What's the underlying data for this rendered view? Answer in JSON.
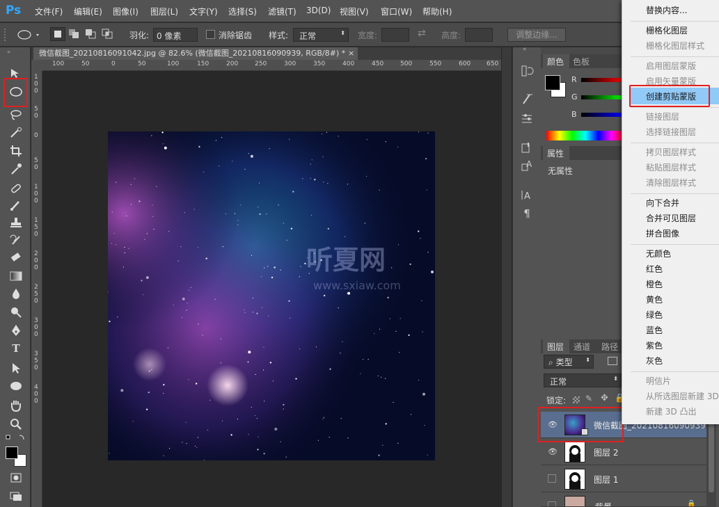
{
  "app": {
    "logo": "Ps"
  },
  "menu": [
    "文件(F)",
    "编辑(E)",
    "图像(I)",
    "图层(L)",
    "文字(Y)",
    "选择(S)",
    "滤镜(T)",
    "3D(D)",
    "视图(V)",
    "窗口(W)",
    "帮助(H)"
  ],
  "options": {
    "feather_label": "羽化:",
    "feather_value": "0 像素",
    "antialias_label": "消除锯齿",
    "style_label": "样式:",
    "style_value": "正常",
    "width_label": "宽度:",
    "height_label": "高度:",
    "refine_button": "调整边缘..."
  },
  "document": {
    "tab_title": "微信截图_20210816091042.jpg @ 82.6% (微信截图_20210816090939, RGB/8#) *",
    "close": "×",
    "ruler_h": [
      "100",
      "50",
      "0",
      "50",
      "100",
      "150",
      "200",
      "250",
      "300",
      "350",
      "400",
      "450",
      "500",
      "550",
      "600",
      "650"
    ],
    "ruler_v": [
      [
        "1",
        "0",
        "0"
      ],
      [
        "5",
        "0"
      ],
      [
        "0"
      ],
      [
        "5",
        "0"
      ],
      [
        "1",
        "0",
        "0"
      ],
      [
        "1",
        "5",
        "0"
      ],
      [
        "2",
        "0",
        "0"
      ],
      [
        "2",
        "5",
        "0"
      ],
      [
        "3",
        "0",
        "0"
      ],
      [
        "3",
        "5",
        "0"
      ],
      [
        "4",
        "0",
        "0"
      ]
    ],
    "watermark": "听夏网",
    "watermark_sub": "www.sxiaw.com"
  },
  "color_panel": {
    "tab_color": "颜色",
    "tab_swatches": "色板",
    "r": "R",
    "g": "G",
    "b": "B"
  },
  "properties_panel": {
    "tab": "属性",
    "content": "无属性"
  },
  "layers_panel": {
    "tab_layers": "图层",
    "tab_channels": "通道",
    "tab_paths": "路径",
    "filter_kind": "类型",
    "blend_mode": "正常",
    "lock_label": "锁定:",
    "layers": [
      {
        "name": "微信截图_20210816090939",
        "visible": true,
        "selected": true
      },
      {
        "name": "图层 2",
        "visible": true,
        "selected": false
      },
      {
        "name": "图层 1",
        "visible": false,
        "selected": false
      },
      {
        "name": "背景",
        "visible": false,
        "selected": false
      }
    ]
  },
  "context_menu": [
    {
      "label": "替换内容...",
      "disabled": false
    },
    {
      "sep": true
    },
    {
      "label": "栅格化图层",
      "disabled": false
    },
    {
      "label": "栅格化图层样式",
      "disabled": true
    },
    {
      "sep": true
    },
    {
      "label": "启用图层蒙版",
      "disabled": true
    },
    {
      "label": "启用矢量蒙版",
      "disabled": true
    },
    {
      "label": "创建剪贴蒙版",
      "disabled": false,
      "highlighted": true
    },
    {
      "sep": true
    },
    {
      "label": "链接图层",
      "disabled": true
    },
    {
      "label": "选择链接图层",
      "disabled": true
    },
    {
      "sep": true
    },
    {
      "label": "拷贝图层样式",
      "disabled": true
    },
    {
      "label": "粘贴图层样式",
      "disabled": true
    },
    {
      "label": "清除图层样式",
      "disabled": true
    },
    {
      "sep": true
    },
    {
      "label": "向下合并",
      "disabled": false
    },
    {
      "label": "合并可见图层",
      "disabled": false
    },
    {
      "label": "拼合图像",
      "disabled": false
    },
    {
      "sep": true
    },
    {
      "label": "无颜色",
      "disabled": false
    },
    {
      "label": "红色",
      "disabled": false
    },
    {
      "label": "橙色",
      "disabled": false
    },
    {
      "label": "黄色",
      "disabled": false
    },
    {
      "label": "绿色",
      "disabled": false
    },
    {
      "label": "蓝色",
      "disabled": false
    },
    {
      "label": "紫色",
      "disabled": false
    },
    {
      "label": "灰色",
      "disabled": false
    },
    {
      "sep": true
    },
    {
      "label": "明信片",
      "disabled": true
    },
    {
      "label": "从所选图层新建 3D",
      "disabled": true
    },
    {
      "label": "新建 3D 凸出",
      "disabled": true
    }
  ],
  "colors": {
    "accent": "#31a8ff",
    "highlight": "#91c9f7",
    "annotation": "#e02020"
  }
}
